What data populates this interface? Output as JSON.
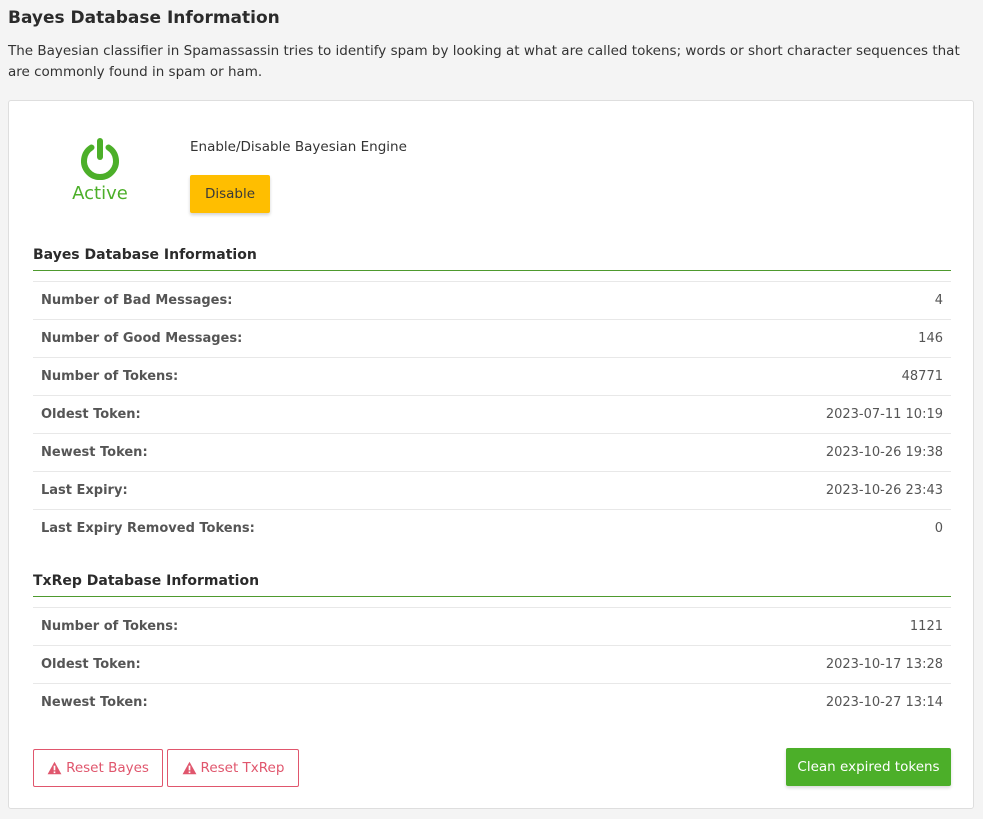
{
  "page": {
    "title": "Bayes Database Information",
    "description": "The Bayesian classifier in Spamassassin tries to identify spam by looking at what are called tokens; words or short character sequences that are commonly found in spam or ham."
  },
  "engine": {
    "status": "Active",
    "label": "Enable/Disable Bayesian Engine",
    "toggle_button": "Disable"
  },
  "bayes": {
    "title": "Bayes Database Information",
    "rows": [
      {
        "label": "Number of Bad Messages:",
        "value": "4"
      },
      {
        "label": "Number of Good Messages:",
        "value": "146"
      },
      {
        "label": "Number of Tokens:",
        "value": "48771"
      },
      {
        "label": "Oldest Token:",
        "value": "2023-07-11 10:19"
      },
      {
        "label": "Newest Token:",
        "value": "2023-10-26 19:38"
      },
      {
        "label": "Last Expiry:",
        "value": "2023-10-26 23:43"
      },
      {
        "label": "Last Expiry Removed Tokens:",
        "value": "0"
      }
    ]
  },
  "txrep": {
    "title": "TxRep Database Information",
    "rows": [
      {
        "label": "Number of Tokens:",
        "value": "1121"
      },
      {
        "label": "Oldest Token:",
        "value": "2023-10-17 13:28"
      },
      {
        "label": "Newest Token:",
        "value": "2023-10-27 13:14"
      }
    ]
  },
  "actions": {
    "reset_bayes": "Reset Bayes",
    "reset_txrep": "Reset TxRep",
    "clean_expired": "Clean expired tokens"
  },
  "colors": {
    "active_green": "#4caf29",
    "warning_yellow": "#ffbe00",
    "danger_red": "#e0566d"
  },
  "icons": {
    "status": "power-icon",
    "reset": "warning-icon"
  }
}
